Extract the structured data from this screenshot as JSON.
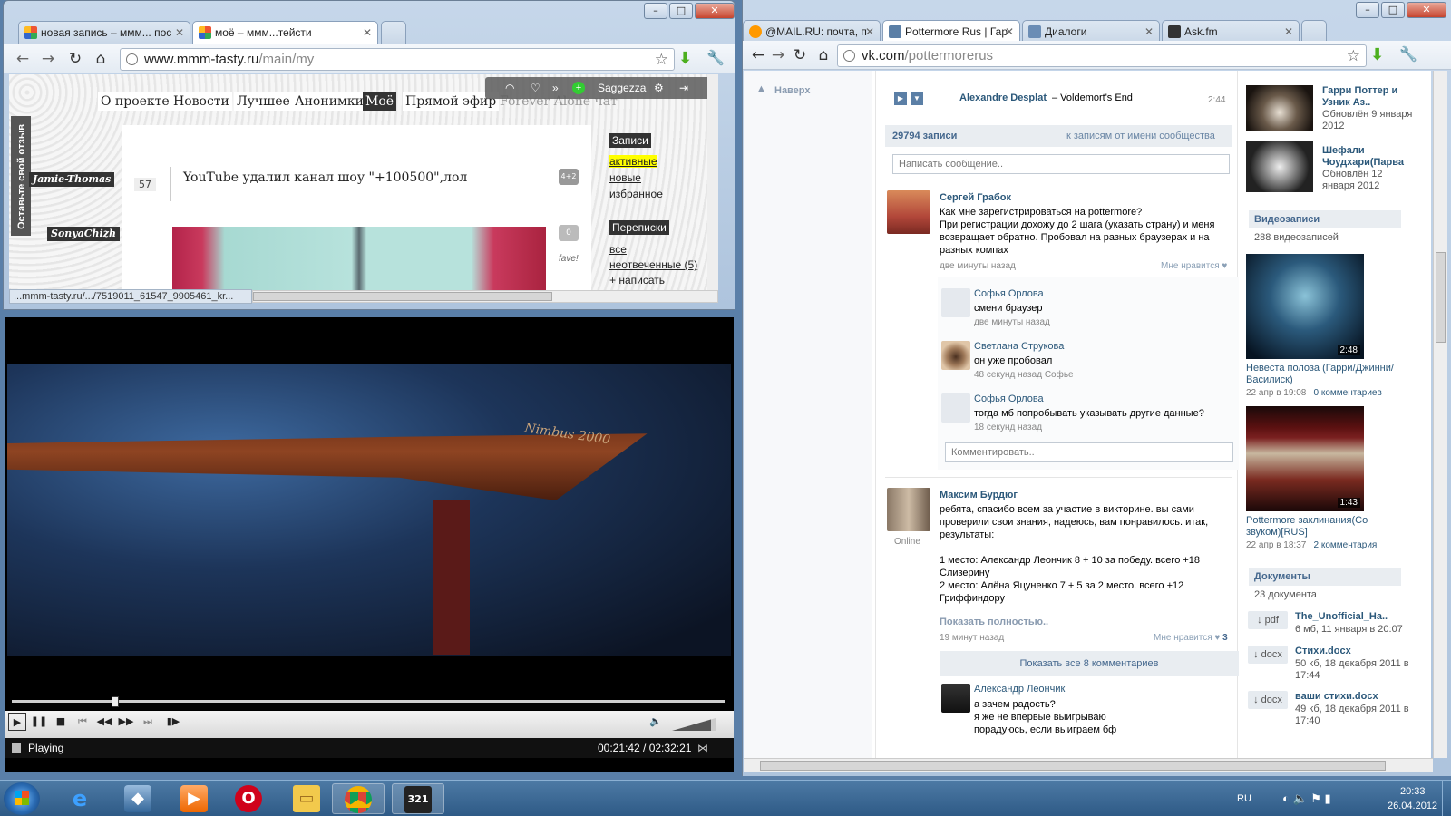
{
  "left_browser": {
    "tabs": [
      {
        "label": "новая запись – ммм... пос",
        "active": false
      },
      {
        "label": "моё – ммм...тейсти",
        "active": true
      }
    ],
    "url_host": "www.mmm-tasty.ru",
    "url_path": "/main/my",
    "menu": [
      "О проекте",
      "Новости",
      "Лучшее",
      "Анонимки",
      "Моё",
      "Прямой эфир",
      "Forever Alone чат"
    ],
    "ext_bar_user": "Saggezza",
    "side_feedback": "Оставьте свой отзыв",
    "nicks": [
      "Jamie-Thomas",
      "SonyaChizh"
    ],
    "post_number": "57",
    "post_title": "YouTube удалил канал шоу \"+100500\",лол",
    "bubble1": "4+2",
    "bubble2": "0",
    "fave": "fave!",
    "right_block": {
      "header1": "Записи",
      "links1": [
        "активные",
        "новые",
        "избранное"
      ],
      "header2": "Переписки",
      "links2": [
        "все",
        "неотвеченные (5)",
        "+ написать"
      ]
    },
    "status_url": "...mmm-tasty.ru/.../7519011_61547_9905461_kr..."
  },
  "media_player": {
    "status": "Playing",
    "time": "00:21:42 / 02:32:21",
    "progress": 0.15,
    "volume": 0.9,
    "frame_caption": "Nimbus 2000"
  },
  "right_browser": {
    "tabs": [
      {
        "label": "@MAIL.RU: почта, п",
        "active": false
      },
      {
        "label": "Pottermore Rus | Гар",
        "active": true
      },
      {
        "label": "Диалоги",
        "active": false
      },
      {
        "label": "Ask.fm",
        "active": false
      }
    ],
    "url_host": "vk.com",
    "url_path": "/pottermorerus"
  },
  "vk": {
    "back_top": "Наверх",
    "audio_artist": "Alexandre Desplat",
    "audio_title": " – Voldemort's End",
    "audio_duration": "2:44",
    "wall_count": "29794 записи",
    "wall_from_community": "к записям от имени сообщества",
    "write_placeholder": "Написать сообщение..",
    "post1": {
      "author": "Сергей Грабок",
      "text": "Как мне зарегистрироваться на pottermore?\nПри регистрации дохожу до 2 шага (указать страну) и меня возвращает обратно. Пробовал на разных браузерах и на разных компах",
      "time": "две минуты назад",
      "like": "Мне нравится"
    },
    "comments1": [
      {
        "author": "Софья Орлова",
        "text": "смени браузер",
        "time": "две минуты назад"
      },
      {
        "author": "Светлана Струкова",
        "text": "он уже пробовал",
        "time": "48 секунд назад Софье"
      },
      {
        "author": "Софья Орлова",
        "text": "тогда мб попробывать указывать другие данные?",
        "time": "18 секунд назад"
      }
    ],
    "comment_placeholder": "Комментировать..",
    "post2": {
      "author": "Максим Бурдюг",
      "online": "Online",
      "text": "ребята, спасибо всем за участие в викторине. вы сами проверили свои знания, надеюсь, вам понравилось. итак, результаты:\n\n1 место: Александр Леончик 8 + 10 за победу. всего +18 Слизерину\n2 место: Алёна Яцуненко 7 + 5 за 2 место. всего +12 Гриффиндору",
      "show_full": "Показать полностью..",
      "time": "19 минут назад",
      "like": "Мне нравится",
      "like_count": "3",
      "show_all_comments": "Показать все 8 комментариев"
    },
    "comment2": {
      "author": "Александр Леончик",
      "text": "а зачем радость?\nя же не впервые выигрываю\nпорадуюсь, если выиграем бф"
    },
    "sidebar": {
      "albums": [
        {
          "title": "Гарри Поттер и Узник Аз..",
          "date": "Обновлён 9 января 2012"
        },
        {
          "title": "Шефали Чоудхари(Парва",
          "date": "Обновлён 12 января 2012"
        }
      ],
      "videos_header": "Видеозаписи",
      "videos_count": "288 видеозаписей",
      "videos": [
        {
          "duration": "2:48",
          "title": "Невеста полоза (Гарри/Джинни/Василиск)",
          "date": "22 апр в 19:08",
          "comments": "0 комментариев"
        },
        {
          "duration": "1:43",
          "title": "Pottermore заклинания(Со звуком)[RUS]",
          "date": "22 апр в 18:37",
          "comments": "2 комментария"
        }
      ],
      "docs_header": "Документы",
      "docs_count": "23 документа",
      "docs": [
        {
          "ext": "pdf",
          "name": "The_Unofficial_Ha..",
          "meta": "6 мб, 11 января в 20:07"
        },
        {
          "ext": "docx",
          "name": "Стихи.docx",
          "meta": "50 кб, 18 декабря 2011 в 17:44"
        },
        {
          "ext": "docx",
          "name": "ваши стихи.docx",
          "meta": "49 кб, 18 декабря 2011 в 17:40"
        }
      ]
    }
  },
  "taskbar": {
    "lang": "RU",
    "time": "20:33",
    "date": "26.04.2012",
    "apps": [
      "start",
      "ie",
      "wmp-alt",
      "media-player",
      "opera",
      "explorer",
      "chrome",
      "mpc"
    ]
  },
  "colors": {
    "vk_blue": "#2b587a",
    "vk_header": "#45688e",
    "tasty_dark": "#333333"
  }
}
